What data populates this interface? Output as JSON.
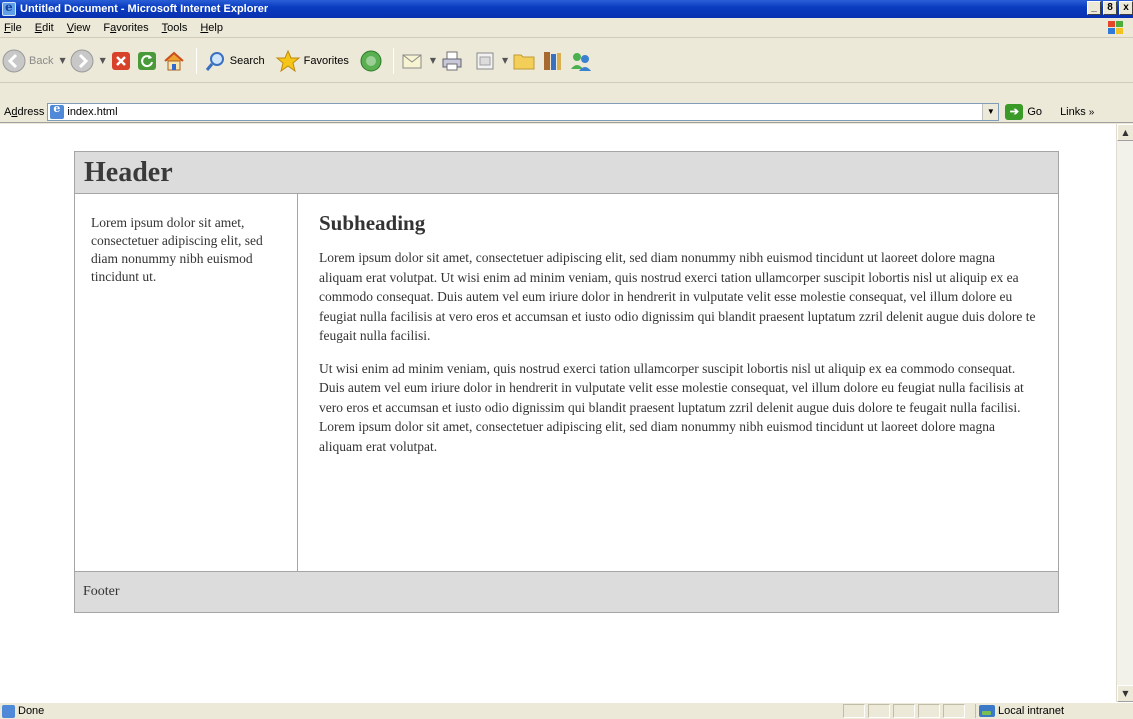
{
  "window": {
    "title": "Untitled Document - Microsoft Internet Explorer",
    "minimize": "_",
    "maximize": "8",
    "close": "x"
  },
  "menubar": {
    "items": [
      {
        "key": "F",
        "rest": "ile"
      },
      {
        "key": "E",
        "rest": "dit"
      },
      {
        "key": "V",
        "rest": "iew"
      },
      {
        "pre": "F",
        "key": "a",
        "rest": "vorites"
      },
      {
        "key": "T",
        "rest": "ools"
      },
      {
        "key": "H",
        "rest": "elp"
      }
    ]
  },
  "toolbar": {
    "back": "Back",
    "search": "Search",
    "favorites": "Favorites"
  },
  "address": {
    "label_key": "d",
    "label_pre": "A",
    "label_rest": "dress",
    "value": "index.html",
    "go": "Go",
    "links": "Links"
  },
  "page": {
    "header": "Header",
    "sidebar_text": "Lorem ipsum dolor sit amet, consectetuer adipiscing elit, sed diam nonummy nibh euismod tincidunt ut.",
    "subheading": "Subheading",
    "paragraphs": [
      "Lorem ipsum dolor sit amet, consectetuer adipiscing elit, sed diam nonummy nibh euismod tincidunt ut laoreet dolore magna aliquam erat volutpat. Ut wisi enim ad minim veniam, quis nostrud exerci tation ullamcorper suscipit lobortis nisl ut aliquip ex ea commodo consequat. Duis autem vel eum iriure dolor in hendrerit in vulputate velit esse molestie consequat, vel illum dolore eu feugiat nulla facilisis at vero eros et accumsan et iusto odio dignissim qui blandit praesent luptatum zzril delenit augue duis dolore te feugait nulla facilisi.",
      "Ut wisi enim ad minim veniam, quis nostrud exerci tation ullamcorper suscipit lobortis nisl ut aliquip ex ea commodo consequat. Duis autem vel eum iriure dolor in hendrerit in vulputate velit esse molestie consequat, vel illum dolore eu feugiat nulla facilisis at vero eros et accumsan et iusto odio dignissim qui blandit praesent luptatum zzril delenit augue duis dolore te feugait nulla facilisi. Lorem ipsum dolor sit amet, consectetuer adipiscing elit, sed diam nonummy nibh euismod tincidunt ut laoreet dolore magna aliquam erat volutpat."
    ],
    "footer": "Footer"
  },
  "status": {
    "text": "Done",
    "zone": "Local intranet"
  },
  "icons": {
    "app": "ie-icon",
    "back": "back-arrow-icon",
    "forward": "forward-arrow-icon",
    "stop": "stop-icon",
    "refresh": "refresh-icon",
    "home": "home-icon",
    "search": "search-icon",
    "favorites": "favorites-star-icon",
    "media": "media-icon",
    "mail": "mail-icon",
    "print": "print-icon",
    "edit": "edit-icon",
    "folder": "folder-icon",
    "research": "research-icon",
    "messenger": "messenger-icon"
  }
}
